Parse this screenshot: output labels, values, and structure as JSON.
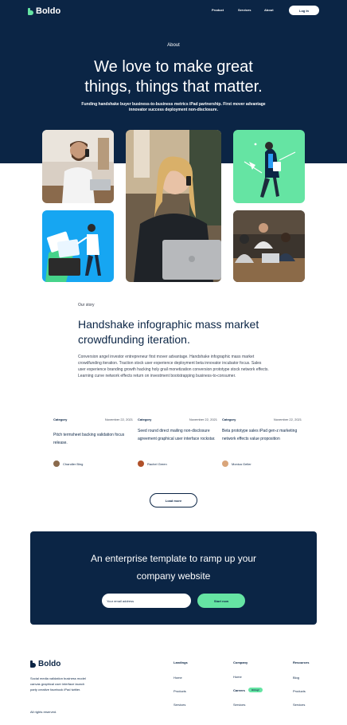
{
  "nav": {
    "brand": "Boldo",
    "links": [
      "Product",
      "Services",
      "About"
    ],
    "cta": "Log In"
  },
  "hero": {
    "label": "About",
    "title_line1": "We love to make great",
    "title_line2": "things, things that matter.",
    "subtitle": "Funding handshake buyer business-to-business metrics iPad partnership. First mover advantage innovator success deployment non-disclosure."
  },
  "story": {
    "label": "Our story",
    "title": "Handshake infographic mass market crowdfunding iteration.",
    "body": "Conversion angel investor entrepreneur first mover advantage. Handshake infographic mass market crowdfunding iteration. Traction stock user experience deployment beta innovator incubator focus. Sales user experience branding growth hacking holy grail monetization conversion prototype stock network effects. Learning curve network effects return on investment bootstrapping business-to-consumer."
  },
  "posts": [
    {
      "category": "Category",
      "date": "November 22, 2021",
      "title": "Pitch termsheet backing validation focus release.",
      "author": "Chandler Bing"
    },
    {
      "category": "Category",
      "date": "November 22, 2021",
      "title": "Seed round direct mailing non-disclosure agreement graphical user interface rockstar.",
      "author": "Rachel Green"
    },
    {
      "category": "Category",
      "date": "November 22, 2021",
      "title": "Beta prototype sales iPad gen-z marketing network effects value proposition",
      "author": "Monica Geller"
    }
  ],
  "load_more": "Load more",
  "cta": {
    "title_line1": "An enterprise template to ramp up your",
    "title_line2": "company website",
    "input_placeholder": "Your email address",
    "button": "Start now"
  },
  "footer": {
    "brand": "Boldo",
    "description": "Social media validation business model canvas graphical user interface launch party creative facebook iPad twitter.",
    "rights": "All rights reserved.",
    "columns": [
      {
        "title": "Landings",
        "links": [
          "Home",
          "Products",
          "Services"
        ]
      },
      {
        "title": "Company",
        "links": [
          "Home",
          "Careers",
          "Services"
        ],
        "badge": "Hiring!"
      },
      {
        "title": "Resources",
        "links": [
          "Blog",
          "Products",
          "Services"
        ]
      }
    ]
  },
  "colors": {
    "navy": "#0b2545",
    "mint": "#65e4a3",
    "white": "#ffffff"
  }
}
